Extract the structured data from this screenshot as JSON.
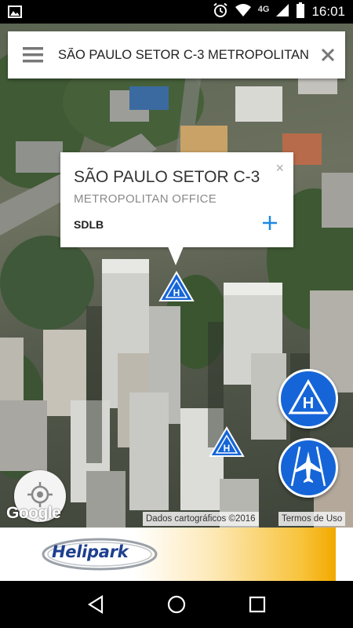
{
  "status_bar": {
    "network": "4G",
    "time": "16:01",
    "icons": [
      "gallery-icon",
      "alarm-icon",
      "wifi-icon",
      "cell-signal-icon",
      "battery-icon"
    ]
  },
  "search": {
    "query": "SÃO PAULO SETOR C-3 METROPOLITAN",
    "menu_icon": "hamburger-menu-icon",
    "clear_icon": "close-icon"
  },
  "info_window": {
    "title": "SÃO PAULO SETOR C-3",
    "subtitle": "METROPOLITAN OFFICE",
    "code": "SDLB",
    "close_symbol": "×",
    "add_icon": "plus-icon"
  },
  "map": {
    "google_logo": "Google",
    "data_attribution": "Dados cartográficos ©2016",
    "terms": "Termos de Uso",
    "markers": [
      "heliport-marker",
      "heliport-marker"
    ],
    "buttons": [
      "heliport-filter-button",
      "airport-filter-button",
      "my-location-button"
    ]
  },
  "banner": {
    "brand": "Helipark"
  },
  "colors": {
    "accent": "#1565d8",
    "banner_gold": "#f8c43d",
    "brand_blue": "#1d3f8f"
  },
  "nav": [
    "back-icon",
    "home-icon",
    "recents-icon"
  ]
}
